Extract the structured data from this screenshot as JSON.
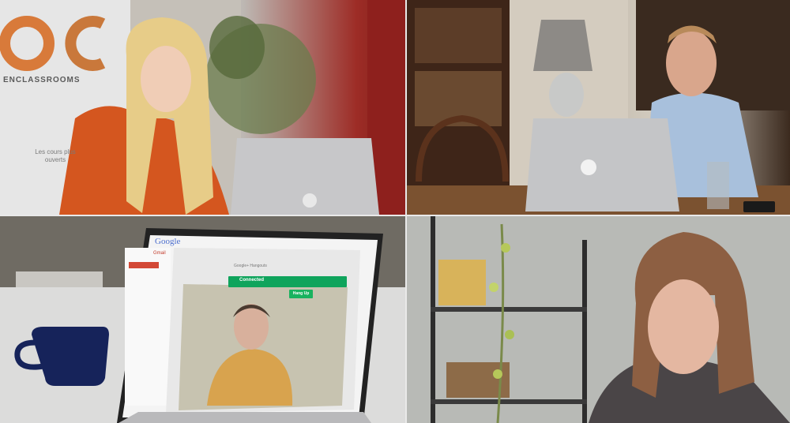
{
  "scene": {
    "tiles": [
      "office-call",
      "study-call",
      "laptop-hangout",
      "home-call"
    ]
  },
  "office_sign": {
    "title": "ENCLASSROOMS",
    "text": "Les cours plus ouverts"
  },
  "laptop_screen": {
    "google_logo": "Google",
    "gmail_label": "Gmail",
    "hangout_title": "Google+ Hangouts",
    "connected_label": "Connected",
    "hangup_label": "Hang Up"
  },
  "colors": {
    "shirt_orange": "#d4561f",
    "hair_blonde": "#e7cc88",
    "shirt_blue": "#aec6e2",
    "mug_navy": "#16235a",
    "hangout_green": "#0fa45c"
  }
}
